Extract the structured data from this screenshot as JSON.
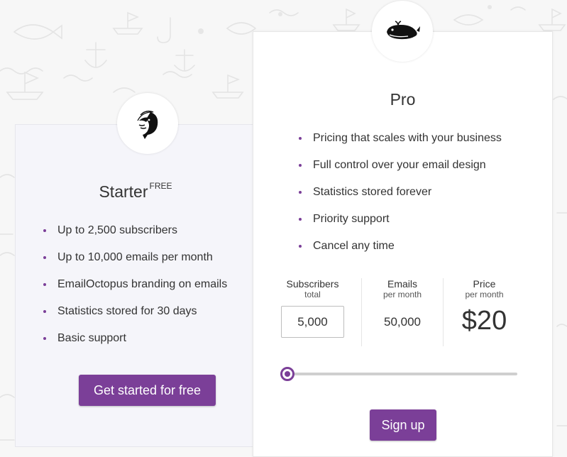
{
  "starter": {
    "icon": "shrimp-icon",
    "title": "Starter",
    "tag": "FREE",
    "features": [
      "Up to 2,500 subscribers",
      "Up to 10,000 emails per month",
      "EmailOctopus branding on emails",
      "Statistics stored for 30 days",
      "Basic support"
    ],
    "button_label": "Get started for free"
  },
  "pro": {
    "icon": "whale-icon",
    "title": "Pro",
    "features": [
      "Pricing that scales with your business",
      "Full control over your email design",
      "Statistics stored forever",
      "Priority support",
      "Cancel any time"
    ],
    "calculator": {
      "subscribers_label": "Subscribers",
      "subscribers_sub": "total",
      "subscribers_value": "5,000",
      "emails_label": "Emails",
      "emails_sub": "per month",
      "emails_value": "50,000",
      "price_label": "Price",
      "price_sub": "per month",
      "price_value": "$20",
      "slider_level": 0
    },
    "button_label": "Sign up"
  },
  "colors": {
    "accent": "#7b3f98",
    "background": "#f7f7f7",
    "starter_card": "#f5f5fa",
    "pro_card": "#ffffff"
  }
}
